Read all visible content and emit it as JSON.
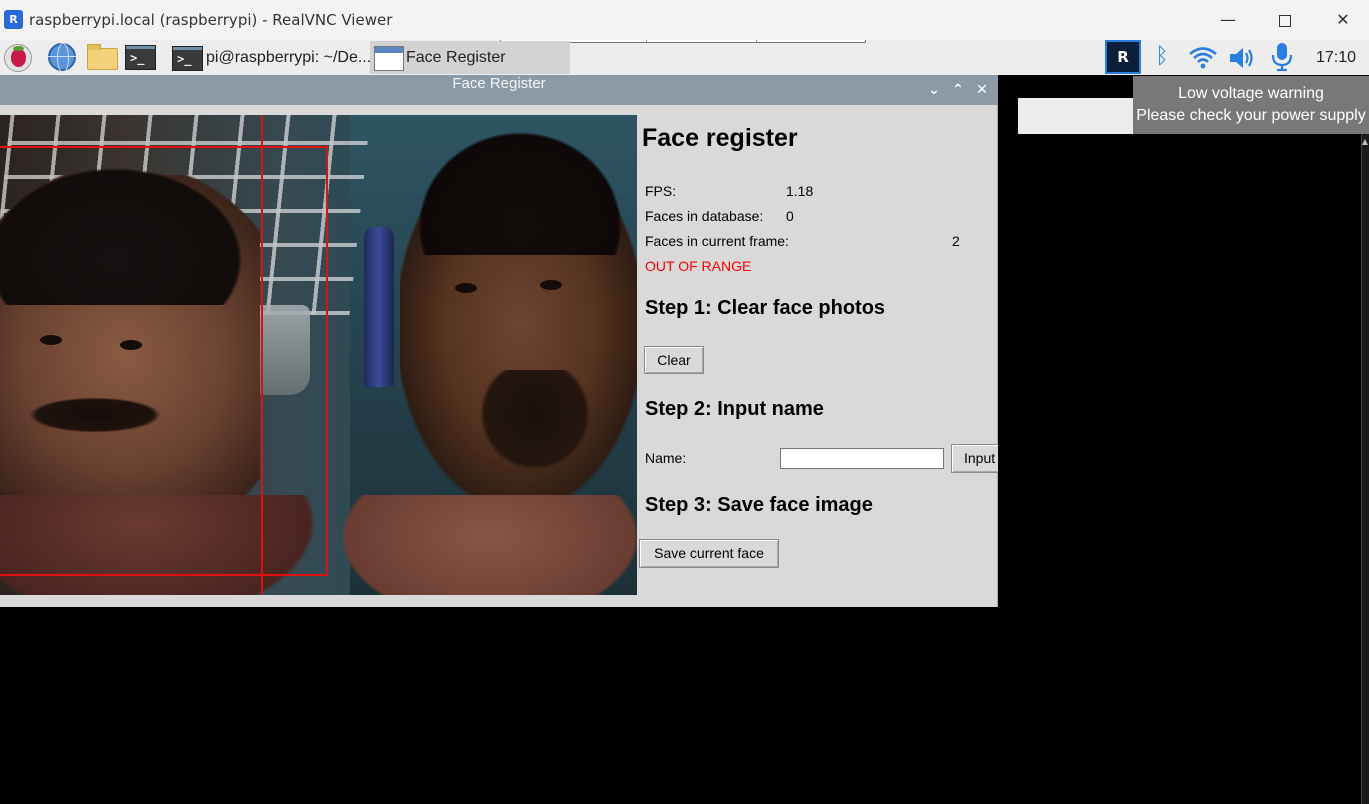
{
  "vnc": {
    "logo_text": "R",
    "title": "raspberrypi.local (raspberrypi) - RealVNC Viewer",
    "minimize_glyph": "—",
    "close_glyph": "✕"
  },
  "taskbar": {
    "terminal_task_label": "pi@raspberrypi: ~/De...",
    "face_task_label": "Face Register",
    "terminal_glyph": ">_",
    "vnc_tray_text": "R",
    "bluetooth_glyph": "ᛒ",
    "clock": "17:10"
  },
  "notification": {
    "line1": "Low voltage warning",
    "line2": "Please check your power supply"
  },
  "app": {
    "window_title": "Face Register",
    "controls": {
      "minimize": "⌄",
      "maximize": "⌃",
      "close": "✕"
    },
    "panel": {
      "title": "Face register",
      "fps_label": "FPS:",
      "fps_value": "1.18",
      "db_label": "Faces in database:",
      "db_value": "0",
      "frame_label": "Faces in current frame:",
      "frame_value": "2",
      "range_warning": "OUT OF RANGE",
      "step1": "Step 1: Clear face photos",
      "clear_button": "Clear",
      "step2": "Step 2: Input name",
      "name_label": "Name:",
      "name_value": "",
      "input_button": "Input",
      "step3": "Step 3: Save face image",
      "save_button": "Save current face"
    }
  },
  "colors": {
    "face_box": "#e01010",
    "warning_text": "#ff0000",
    "app_titlebar": "#8a9aa7",
    "tray_accent": "#2a7ee0"
  }
}
